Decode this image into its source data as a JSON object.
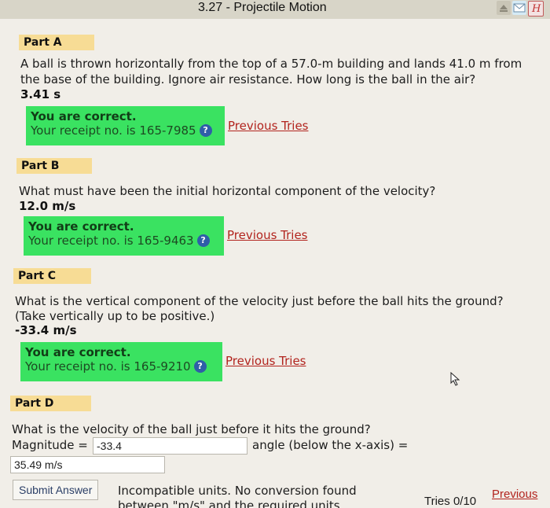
{
  "header": {
    "title": "3.27 - Projectile Motion",
    "icons": [
      "eject-icon",
      "mail-icon",
      "help-book-icon"
    ]
  },
  "partA": {
    "label": "Part A",
    "question_line1": "A ball is thrown horizontally from the top of a 57.0-m building and lands 41.0 m from",
    "question_line2": "the base of the building. Ignore air resistance. How long is the ball in the air?",
    "answer": "3.41 s",
    "correct_title": "You are correct.",
    "receipt": "Your receipt no. is 165-7985",
    "previous_tries": "Previous Tries"
  },
  "partB": {
    "label": "Part B",
    "question": "What must have been the initial horizontal component of the velocity?",
    "answer": "12.0 m/s",
    "correct_title": "You are correct.",
    "receipt": "Your receipt no. is 165-9463",
    "previous_tries": "Previous Tries"
  },
  "partC": {
    "label": "Part C",
    "question_line1": "What is the vertical component of the velocity just before the ball hits the ground?",
    "question_line2": "(Take vertically up to be positive.)",
    "answer": "-33.4 m/s",
    "correct_title": "You are correct.",
    "receipt": "Your receipt no. is 165-9210",
    "previous_tries": "Previous Tries"
  },
  "partD": {
    "label": "Part D",
    "question": "What is the velocity of the ball just before it hits the ground?",
    "magnitude_label": "Magnitude =",
    "magnitude_value": "-33.4",
    "angle_label": "angle (below the x-axis) =",
    "angle_value": "35.49 m/s",
    "submit_label": "Submit Answer",
    "feedback_line1": "Incompatible units. No conversion found",
    "feedback_line2": "between \"m/s\" and the required units.",
    "tries": "Tries 0/10",
    "previous_tries": "Previous"
  },
  "help_glyph": "?",
  "colors": {
    "correct_bg": "#3ae261",
    "label_bg": "#f7dc95",
    "link": "#b2241e"
  }
}
